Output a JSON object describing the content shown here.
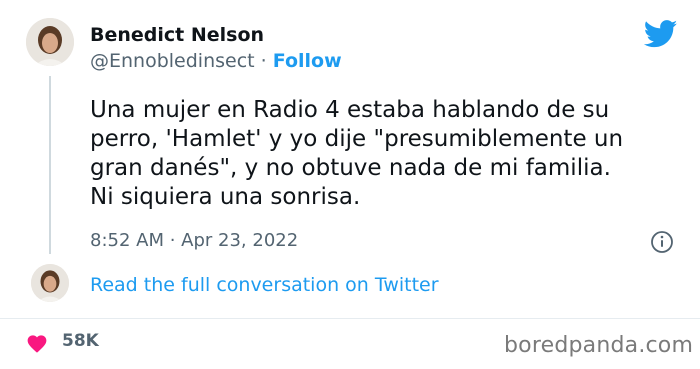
{
  "author": {
    "name": "Benedict Nelson",
    "handle": "@Ennobledinsect",
    "separator": "·",
    "follow_label": "Follow"
  },
  "tweet": {
    "text": "Una mujer en Radio 4 estaba hablando de su\nperro, 'Hamlet' y yo dije \"presumiblemente un\ngran danés\", y no obtuve nada de mi familia.\nNi siquiera una sonrisa.",
    "timestamp": "8:52 AM · Apr 23, 2022"
  },
  "conversation_link": "Read the full conversation on Twitter",
  "likes": "58K",
  "watermark": "boredpanda.com",
  "icons": {
    "logo": "twitter-bird-icon",
    "info": "info-icon",
    "like": "heart-icon"
  },
  "colors": {
    "twitter_blue": "#1d9bf0",
    "heart_red": "#f91880",
    "muted_text": "#536471"
  }
}
